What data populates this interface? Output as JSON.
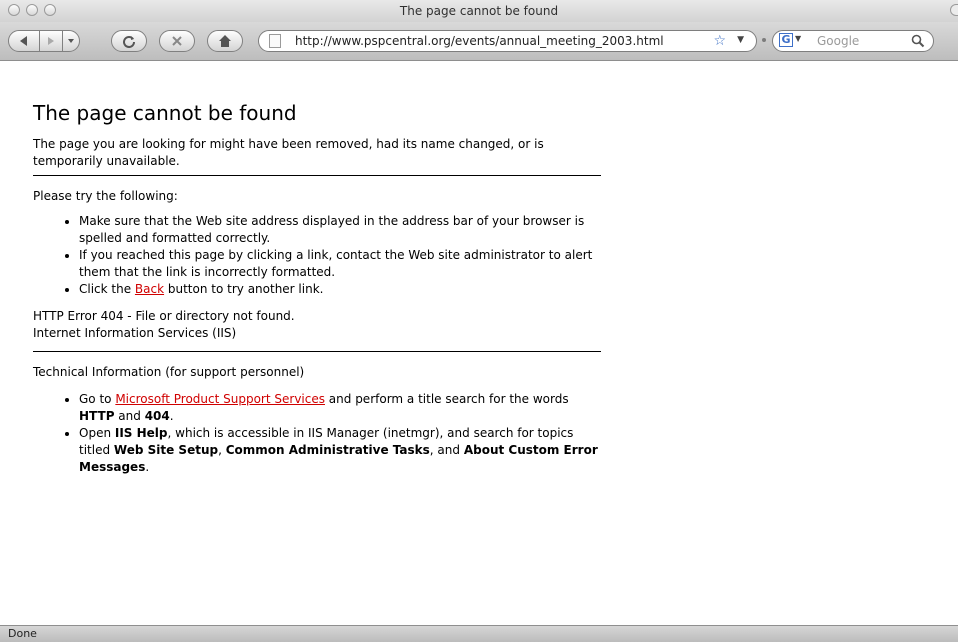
{
  "window": {
    "title": "The page cannot be found"
  },
  "toolbar": {
    "url": "http://www.pspcentral.org/events/annual_meeting_2003.html",
    "search_placeholder": "Google",
    "search_engine_letter": "G"
  },
  "page": {
    "heading": "The page cannot be found",
    "intro": "The page you are looking for might have been removed, had its name changed, or is temporarily unavailable.",
    "try_heading": "Please try the following:",
    "bullet1": "Make sure that the Web site address displayed in the address bar of your browser is spelled and formatted correctly.",
    "bullet2": "If you reached this page by clicking a link, contact the Web site administrator to alert them that the link is incorrectly formatted.",
    "bullet3_pre": "Click the ",
    "bullet3_link": "Back",
    "bullet3_post": " button to try another link.",
    "error_line": "HTTP Error 404 - File or directory not found.",
    "server_line": "Internet Information Services (IIS)",
    "tech_heading": "Technical Information (for support personnel)",
    "tech1_pre": "Go to ",
    "tech1_link": "Microsoft Product Support Services",
    "tech1_mid": " and perform a title search for the words ",
    "tech1_b1": "HTTP",
    "tech1_and": " and ",
    "tech1_b2": "404",
    "tech1_end": ".",
    "tech2_pre": "Open ",
    "tech2_b1": "IIS Help",
    "tech2_mid": ", which is accessible in IIS Manager (inetmgr), and search for topics titled ",
    "tech2_b2": "Web Site Setup",
    "tech2_comma": ", ",
    "tech2_b3": "Common Administrative Tasks",
    "tech2_and": ", and ",
    "tech2_b4": "About Custom Error Messages",
    "tech2_end": "."
  },
  "status": {
    "text": "Done"
  },
  "icons": [
    "close-icon",
    "minimize-icon",
    "zoom-icon",
    "back-icon",
    "forward-icon",
    "history-dropdown-icon",
    "reload-icon",
    "stop-icon",
    "home-icon",
    "page-icon",
    "bookmark-star-icon",
    "search-magnifier-icon"
  ]
}
